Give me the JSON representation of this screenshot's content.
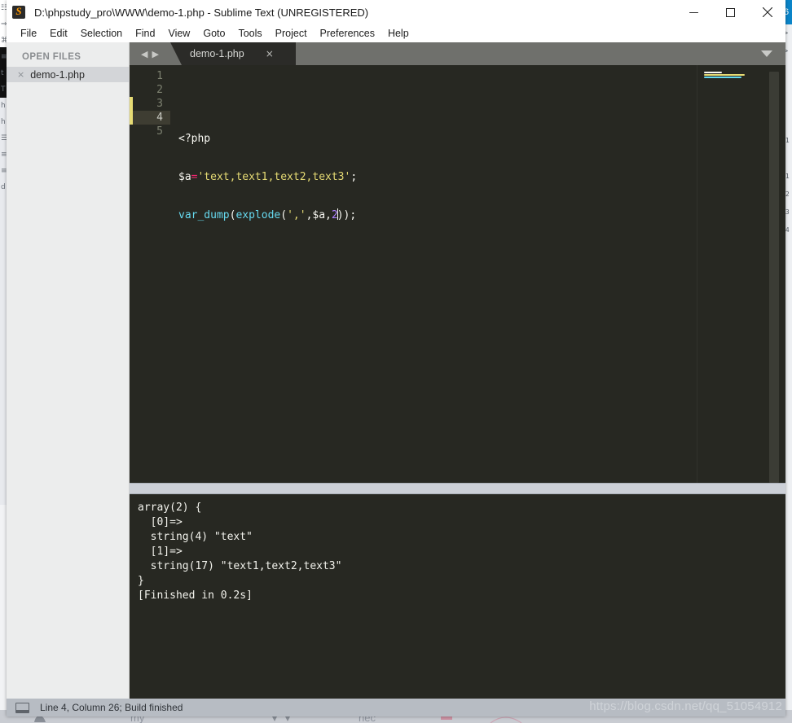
{
  "window": {
    "title": "D:\\phpstudy_pro\\WWW\\demo-1.php - Sublime Text (UNREGISTERED)",
    "app_icon": "sublime-text-icon",
    "controls": {
      "minimize": "—",
      "maximize": "☐",
      "close": "✕"
    }
  },
  "menubar": {
    "items": [
      {
        "label": "File"
      },
      {
        "label": "Edit"
      },
      {
        "label": "Selection"
      },
      {
        "label": "Find"
      },
      {
        "label": "View"
      },
      {
        "label": "Goto"
      },
      {
        "label": "Tools"
      },
      {
        "label": "Project"
      },
      {
        "label": "Preferences"
      },
      {
        "label": "Help"
      }
    ]
  },
  "sidebar": {
    "header": "OPEN FILES",
    "files": [
      {
        "name": "demo-1.php",
        "close_glyph": "×"
      }
    ]
  },
  "tabbar": {
    "nav_prev": "◀",
    "nav_next": "▶",
    "tabs": [
      {
        "label": "demo-1.php",
        "close_glyph": "×",
        "active": true
      }
    ],
    "dropdown_icon": "chevron-down-icon"
  },
  "editor": {
    "line_numbers": [
      "1",
      "2",
      "3",
      "4",
      "5"
    ],
    "active_line": 4,
    "lines": [
      {
        "n": 1,
        "tokens": []
      },
      {
        "n": 2,
        "tokens": [
          {
            "t": "<?php",
            "c": "plain"
          }
        ]
      },
      {
        "n": 3,
        "tokens": [
          {
            "t": "$a",
            "c": "plain"
          },
          {
            "t": "=",
            "c": "op"
          },
          {
            "t": "'text,text1,text2,text3'",
            "c": "str"
          },
          {
            "t": ";",
            "c": "punc"
          }
        ]
      },
      {
        "n": 4,
        "tokens": [
          {
            "t": "var_dump",
            "c": "fn"
          },
          {
            "t": "(",
            "c": "punc"
          },
          {
            "t": "explode",
            "c": "fn"
          },
          {
            "t": "(",
            "c": "punc"
          },
          {
            "t": "','",
            "c": "str"
          },
          {
            "t": ",",
            "c": "punc"
          },
          {
            "t": "$a",
            "c": "plain"
          },
          {
            "t": ",",
            "c": "punc"
          },
          {
            "t": "2",
            "c": "num"
          },
          {
            "t": "CARET",
            "c": "caret"
          },
          {
            "t": ")",
            "c": "punc"
          },
          {
            "t": ")",
            "c": "punc"
          },
          {
            "t": ";",
            "c": "punc"
          }
        ]
      },
      {
        "n": 5,
        "tokens": []
      }
    ],
    "colors": {
      "background": "#272822",
      "plain": "#f8f8f2",
      "operator": "#f92672",
      "string": "#e6db74",
      "function": "#66d9ef",
      "number": "#ae81ff",
      "active_line": "#3e3d32",
      "gutter_mark": "#e6db74"
    }
  },
  "console": {
    "output": "array(2) {\n  [0]=>\n  string(4) \"text\"\n  [1]=>\n  string(17) \"text1,text2,text3\"\n}\n[Finished in 0.2s]"
  },
  "statusbar": {
    "panel_icon": "panel-icon",
    "text": "Line 4, Column 26; Build finished",
    "watermark": "https://blog.csdn.net/qq_51054912"
  },
  "background_windows": {
    "left_glyphs": "☷\n⇒\n⌘\n≡\nt\nT\nh\nh\n☰\n≡\n≡\nd",
    "right_tab_label": "6",
    "right_glyphs": "≫\n≫\n≡\n≡\n≡\n⊞\n[1\n≡\n[1\n[2\n[3\n[4\n2"
  }
}
